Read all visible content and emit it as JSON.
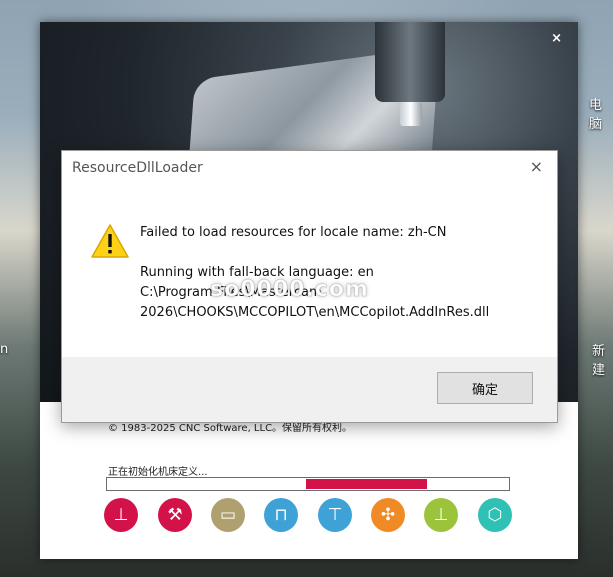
{
  "desktop": {
    "right_label_1": "电脑",
    "right_label_2": "新建",
    "left_label": "n"
  },
  "splash": {
    "close_glyph": "×",
    "copyright": "© 1983-2025 CNC Software, LLC。保留所有权利。",
    "status": "正在初始化机床定义...",
    "progress_segment": {
      "start": 0.495,
      "end": 0.796,
      "color": "#d4124a"
    },
    "icons": [
      {
        "name": "mill-icon",
        "glyph": "⊥",
        "color": "#d4124a"
      },
      {
        "name": "router-icon",
        "glyph": "⚒",
        "color": "#d4124a"
      },
      {
        "name": "design-icon",
        "glyph": "▭",
        "color": "#b0a070"
      },
      {
        "name": "multiaxis-icon",
        "glyph": "⊓",
        "color": "#3ea2d6"
      },
      {
        "name": "lathe-icon",
        "glyph": "⊤",
        "color": "#3ea2d6"
      },
      {
        "name": "wire-icon",
        "glyph": "✣",
        "color": "#f08a24"
      },
      {
        "name": "mill-turn-icon",
        "glyph": "⊥",
        "color": "#9bc43c"
      },
      {
        "name": "3d-icon",
        "glyph": "⬡",
        "color": "#2ec1b4"
      }
    ]
  },
  "dialog": {
    "title": "ResourceDllLoader",
    "close_glyph": "×",
    "line1": "Failed to load resources for locale name: zh-CN",
    "line2": "Running with fall-back language: en",
    "line3": "C:\\Program Files\\Mastercam",
    "line4": "2026\\CHOOKS\\MCCOPILOT\\en\\MCCopilot.AddInRes.dll",
    "ok_label": "确定"
  },
  "watermark": "so0000.com"
}
